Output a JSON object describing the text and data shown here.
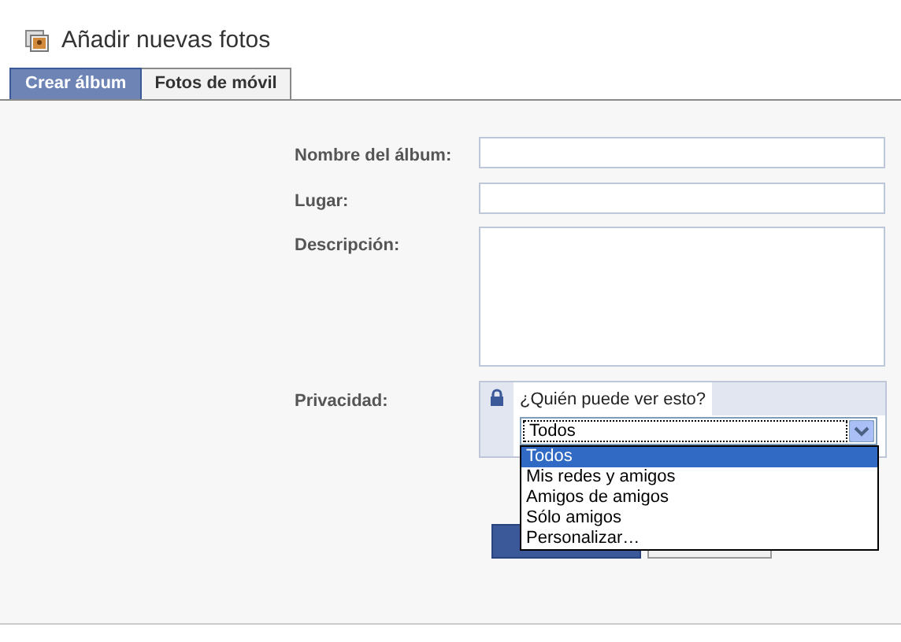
{
  "title": "Añadir nuevas fotos",
  "tabs": [
    {
      "label": "Crear álbum",
      "selected": true
    },
    {
      "label": "Fotos de móvil",
      "selected": false
    }
  ],
  "form": {
    "fields": [
      {
        "label": "Nombre del álbum:",
        "kind": "input"
      },
      {
        "label": "Lugar:",
        "kind": "input"
      },
      {
        "label": "Descripción:",
        "kind": "textarea"
      }
    ],
    "privacy": {
      "label": "Privacidad:",
      "prompt": "¿Quién puede ver esto?",
      "value": "Todos",
      "expanded": true,
      "options": [
        {
          "label": "Todos",
          "selected": true
        },
        {
          "label": "Mis redes y amigos",
          "selected": false
        },
        {
          "label": "Amigos de amigos",
          "selected": false
        },
        {
          "label": "Sólo amigos",
          "selected": false
        },
        {
          "label": "Personalizar…",
          "selected": false
        }
      ]
    }
  }
}
